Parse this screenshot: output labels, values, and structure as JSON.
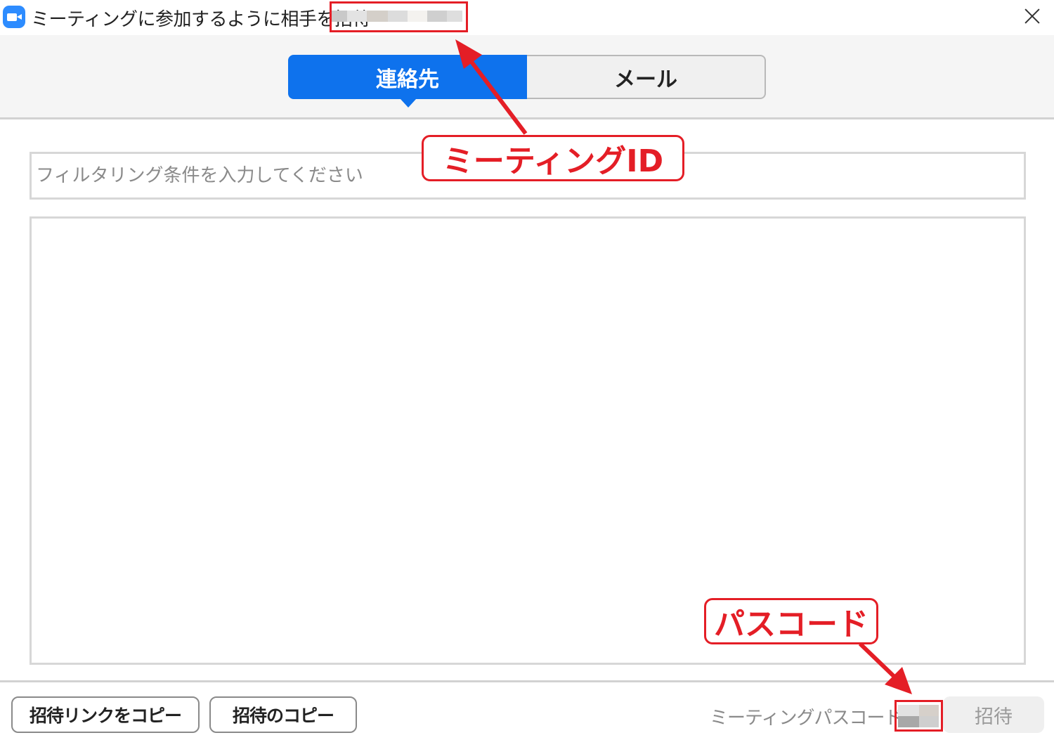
{
  "window": {
    "title": "ミーティングに参加するように相手を招待",
    "close_icon": "close-icon"
  },
  "tabs": [
    {
      "label": "連絡先",
      "active": true
    },
    {
      "label": "メール",
      "active": false
    }
  ],
  "search": {
    "placeholder": "フィルタリング条件を入力してください",
    "value": ""
  },
  "footer": {
    "copy_link_label": "招待リンクをコピー",
    "copy_invitation_label": "招待のコピー",
    "passcode_label": "ミーティングパスコード：",
    "invite_label": "招待"
  },
  "annotations": {
    "meeting_id_label": "ミーティングID",
    "passcode_label": "パスコード"
  },
  "colors": {
    "accent": "#0e72ed",
    "annotation": "#e41e26"
  }
}
